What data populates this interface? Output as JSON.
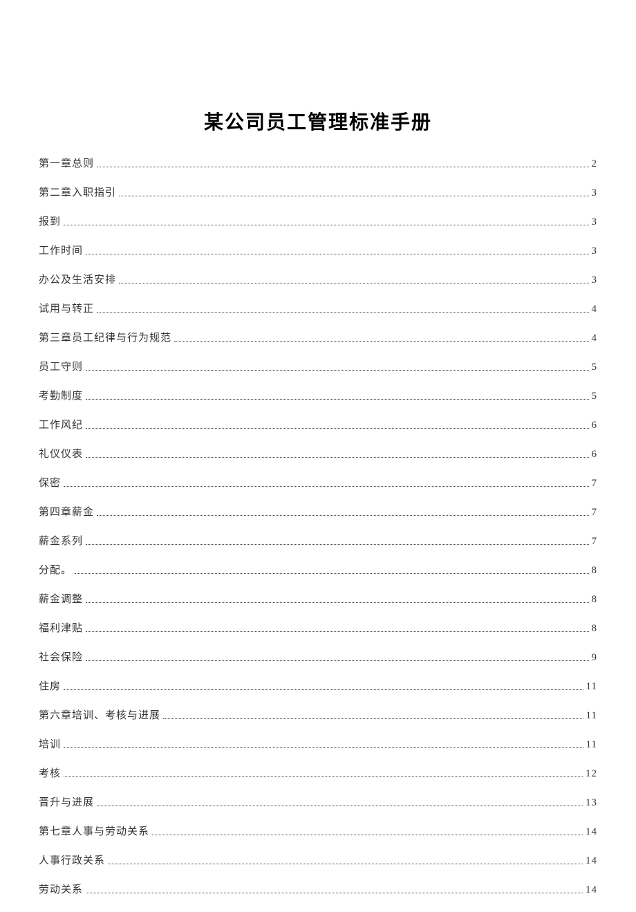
{
  "title": "某公司员工管理标准手册",
  "toc": [
    {
      "label": "第一章总则",
      "page": "2"
    },
    {
      "label": "第二章入职指引",
      "page": "3"
    },
    {
      "label": "报到",
      "page": "3"
    },
    {
      "label": "工作时间",
      "page": "3"
    },
    {
      "label": "办公及生活安排",
      "page": "3"
    },
    {
      "label": "试用与转正",
      "page": "4"
    },
    {
      "label": "第三章员工纪律与行为规范",
      "page": "4"
    },
    {
      "label": "员工守则",
      "page": "5"
    },
    {
      "label": "考勤制度",
      "page": "5"
    },
    {
      "label": "工作风纪",
      "page": "6"
    },
    {
      "label": "礼仪仪表",
      "page": "6"
    },
    {
      "label": "保密",
      "page": "7"
    },
    {
      "label": "第四章薪金",
      "page": "7"
    },
    {
      "label": "薪金系列",
      "page": "7"
    },
    {
      "label": "分配。",
      "page": "8"
    },
    {
      "label": "薪金调整",
      "page": "8"
    },
    {
      "label": "福利津贴",
      "page": "8"
    },
    {
      "label": "社会保险",
      "page": "9"
    },
    {
      "label": "住房",
      "page": "11"
    },
    {
      "label": "第六章培训、考核与进展",
      "page": "11"
    },
    {
      "label": "培训",
      "page": "11"
    },
    {
      "label": "考核",
      "page": "12"
    },
    {
      "label": "晋升与进展",
      "page": "13"
    },
    {
      "label": "第七章人事与劳动关系",
      "page": "14"
    },
    {
      "label": "人事行政关系",
      "page": "14"
    },
    {
      "label": "劳动关系",
      "page": "14"
    }
  ]
}
